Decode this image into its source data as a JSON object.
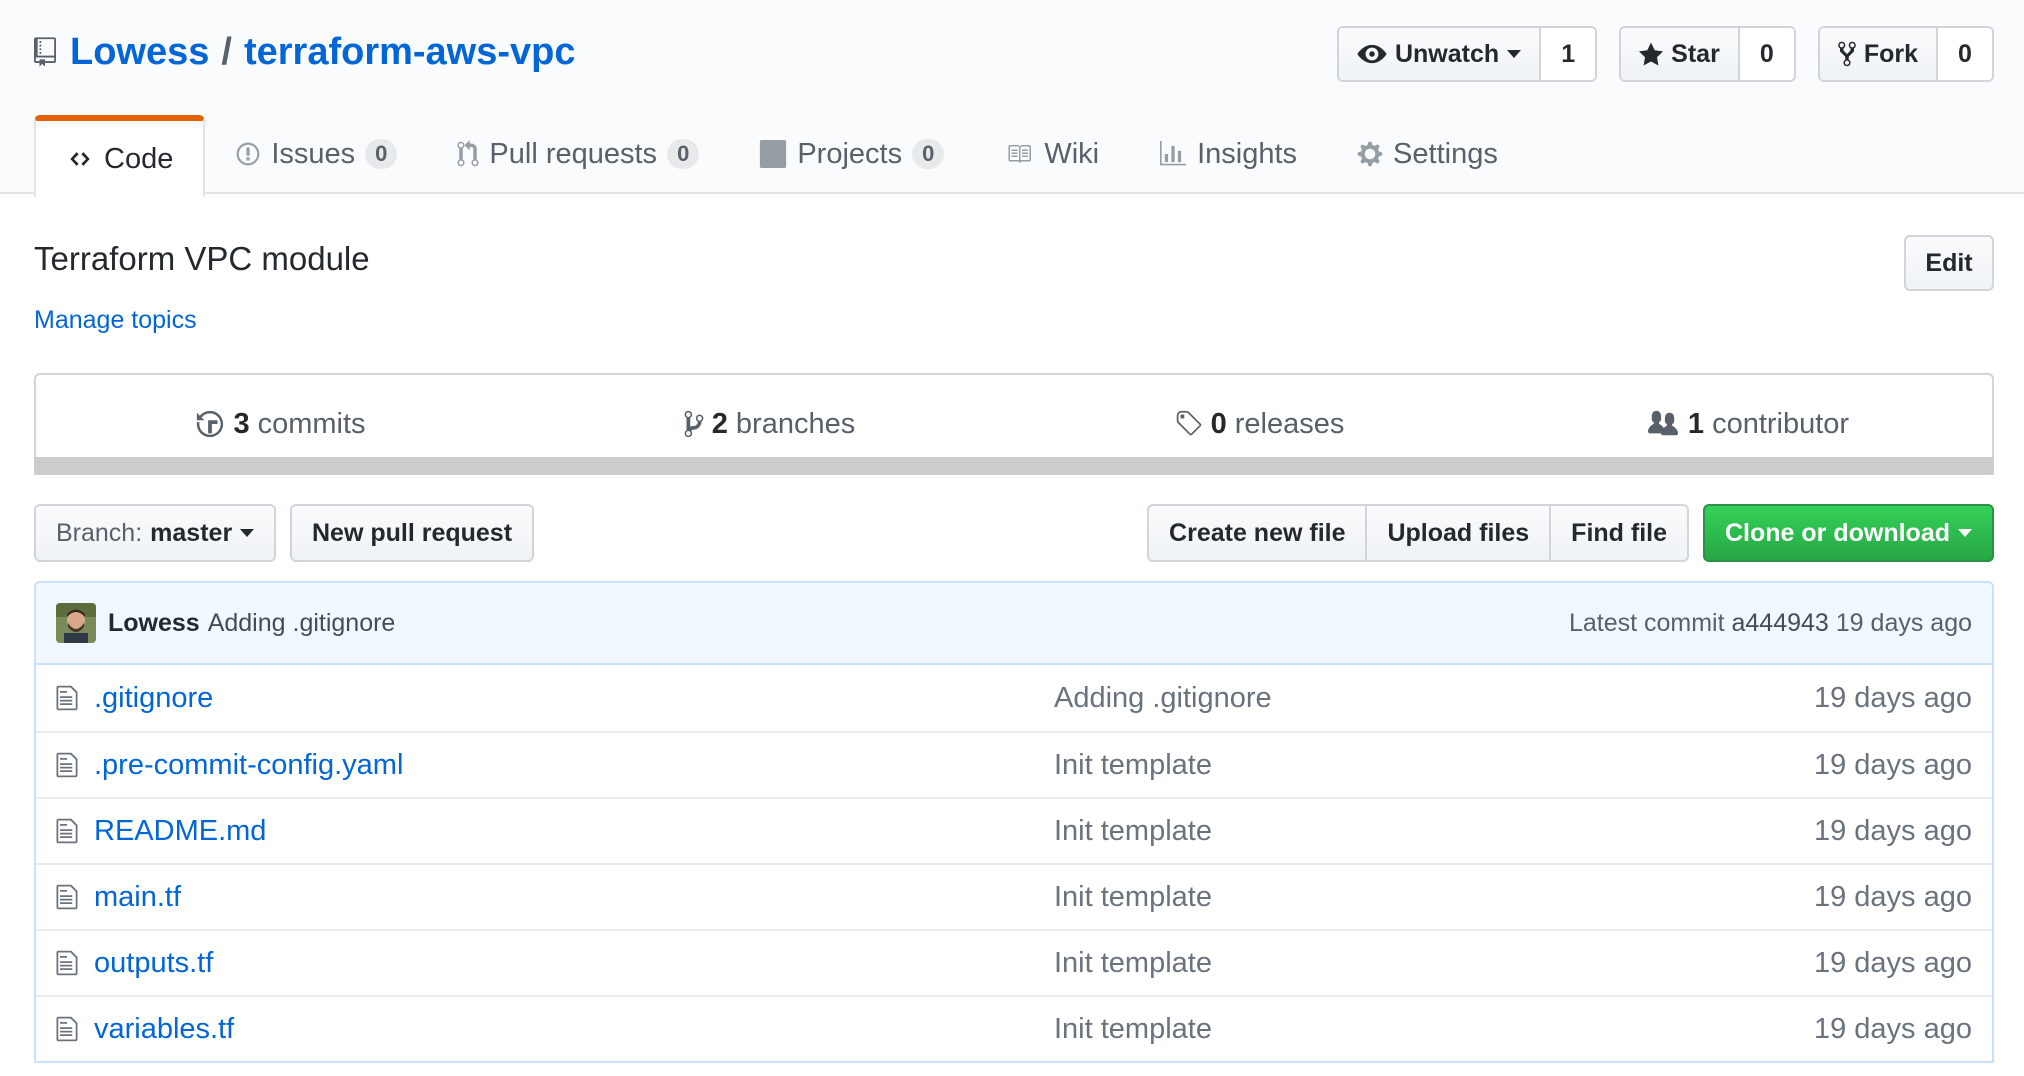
{
  "repo": {
    "owner": "Lowess",
    "separator": "/",
    "name": "terraform-aws-vpc"
  },
  "actions": {
    "watch": {
      "label": "Unwatch",
      "count": "1"
    },
    "star": {
      "label": "Star",
      "count": "0"
    },
    "fork": {
      "label": "Fork",
      "count": "0"
    }
  },
  "tabs": [
    {
      "label": "Code",
      "icon": "code-icon",
      "selected": true
    },
    {
      "label": "Issues",
      "counter": "0",
      "icon": "issue-icon"
    },
    {
      "label": "Pull requests",
      "counter": "0",
      "icon": "pull-request-icon"
    },
    {
      "label": "Projects",
      "counter": "0",
      "icon": "project-icon"
    },
    {
      "label": "Wiki",
      "icon": "book-icon"
    },
    {
      "label": "Insights",
      "icon": "graph-icon"
    },
    {
      "label": "Settings",
      "icon": "gear-icon"
    }
  ],
  "description": {
    "text": "Terraform VPC module",
    "manage_topics": "Manage topics",
    "edit_label": "Edit"
  },
  "summary": {
    "commits": {
      "count": "3",
      "label": "commits"
    },
    "branches": {
      "count": "2",
      "label": "branches"
    },
    "releases": {
      "count": "0",
      "label": "releases"
    },
    "contributors": {
      "count": "1",
      "label": "contributor"
    }
  },
  "file_nav": {
    "branch_prefix": "Branch:",
    "branch": "master",
    "new_pr": "New pull request",
    "create_file": "Create new file",
    "upload_files": "Upload files",
    "find_file": "Find file",
    "clone": "Clone or download"
  },
  "commit": {
    "author": "Lowess",
    "message": "Adding .gitignore",
    "latest_label": "Latest commit",
    "sha": "a444943",
    "age": "19 days ago"
  },
  "files": [
    {
      "name": ".gitignore",
      "message": "Adding .gitignore",
      "age": "19 days ago"
    },
    {
      "name": ".pre-commit-config.yaml",
      "message": "Init template",
      "age": "19 days ago"
    },
    {
      "name": "README.md",
      "message": "Init template",
      "age": "19 days ago"
    },
    {
      "name": "main.tf",
      "message": "Init template",
      "age": "19 days ago"
    },
    {
      "name": "outputs.tf",
      "message": "Init template",
      "age": "19 days ago"
    },
    {
      "name": "variables.tf",
      "message": "Init template",
      "age": "19 days ago"
    }
  ],
  "colors": {
    "link": "#0366d6",
    "selected_tab_accent": "#e36209",
    "green_button": "#28a745",
    "commit_tease_bg": "#f1f8ff"
  }
}
